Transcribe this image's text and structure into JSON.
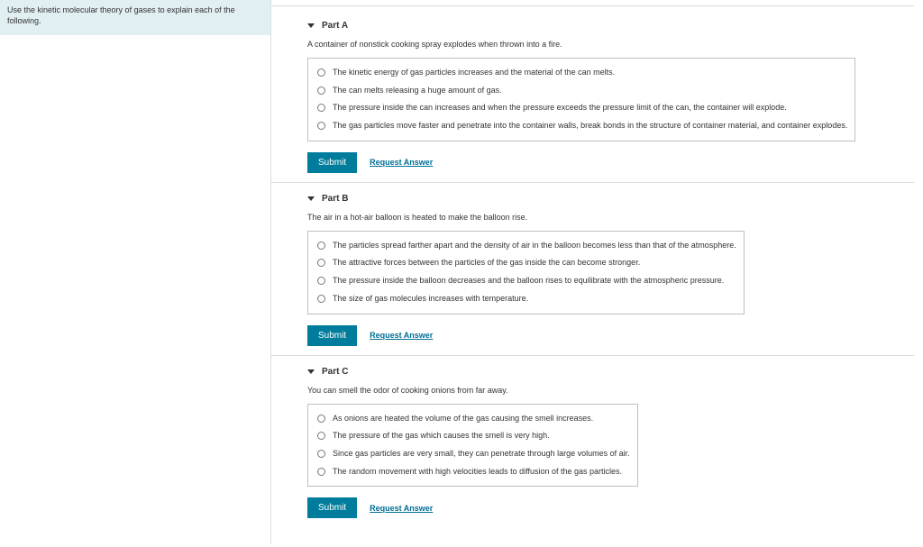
{
  "hint": "Use the kinetic molecular theory of gases to explain each of the following.",
  "submit_label": "Submit",
  "request_label": "Request Answer",
  "parts": [
    {
      "title": "Part A",
      "prompt": "A container of nonstick cooking spray explodes when thrown into a fire.",
      "options": [
        "The kinetic energy of gas particles increases and the material of the can melts.",
        "The can melts releasing a huge amount of gas.",
        "The pressure inside the can increases and when the pressure exceeds the pressure limit of the can, the container will explode.",
        "The gas particles move faster and penetrate into the container walls, break bonds in the structure of container material, and container explodes."
      ]
    },
    {
      "title": "Part B",
      "prompt": "The air in a hot-air balloon is heated to make the balloon rise.",
      "options": [
        "The particles spread farther apart and the density of air in the balloon becomes less than that of the atmosphere.",
        "The attractive forces between the particles of the gas inside the can become stronger.",
        "The pressure inside the balloon decreases and the balloon rises to equilibrate with the atmospheric pressure.",
        "The size of gas molecules increases with temperature."
      ]
    },
    {
      "title": "Part C",
      "prompt": "You can smell the odor of cooking onions from far away.",
      "options": [
        "As onions are heated the volume of the gas causing the smell increases.",
        "The pressure of the gas which causes the smell is very high.",
        "Since gas particles are very small, they can penetrate through large volumes of air.",
        "The random movement with high velocities leads to diffusion of the gas particles."
      ]
    }
  ]
}
